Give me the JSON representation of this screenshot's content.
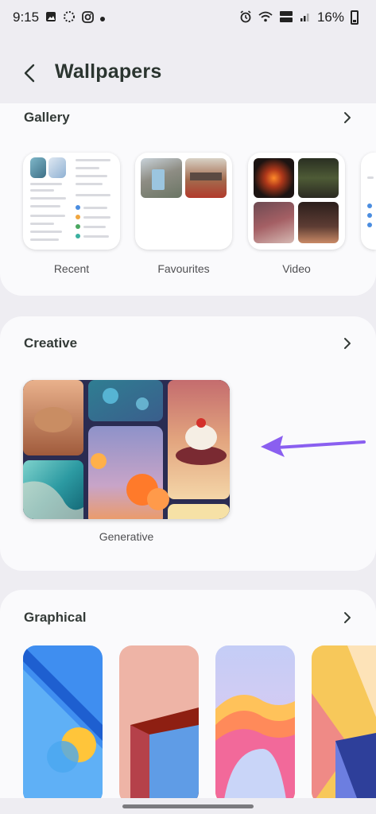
{
  "status_bar": {
    "time": "9:15",
    "battery": "16%"
  },
  "header": {
    "title": "Wallpapers"
  },
  "gallery": {
    "title": "Gallery",
    "items": [
      {
        "label": "Recent"
      },
      {
        "label": "Favourites"
      },
      {
        "label": "Video"
      }
    ]
  },
  "creative": {
    "title": "Creative",
    "items": [
      {
        "label": "Generative"
      }
    ]
  },
  "graphical": {
    "title": "Graphical"
  },
  "colors": {
    "accent_arrow": "#8a5ff0",
    "background": "#eeedf2",
    "card": "#fafafc"
  }
}
